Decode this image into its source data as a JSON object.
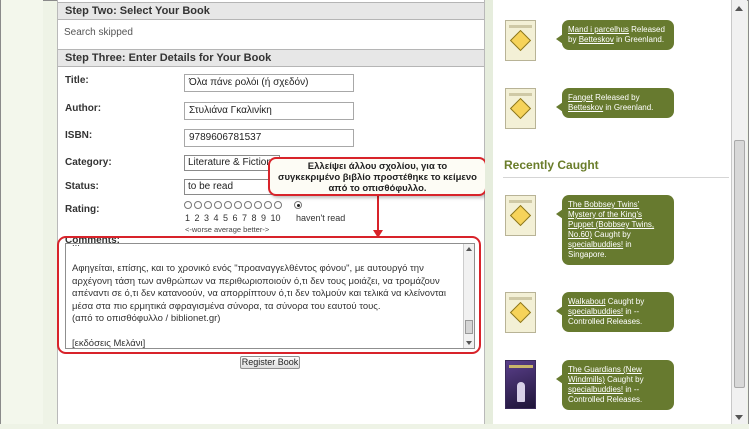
{
  "form": {
    "step_two_title": "Step Two: Select Your Book",
    "search_skipped": "Search skipped",
    "step_three_title": "Step Three: Enter Details for Your Book",
    "title_label": "Title:",
    "title_value": "Όλα πάνε ρολόι (ή σχεδόν)",
    "author_label": "Author:",
    "author_value": "Στυλιάνα Γκαλινίκη",
    "isbn_label": "ISBN:",
    "isbn_value": "9789606781537",
    "category_label": "Category:",
    "category_value": "Literature & Fiction",
    "status_label": "Status:",
    "status_value": "to be read",
    "rating_label": "Rating:",
    "rating_numbers": "1 2 3 4 5 6 7 8 9 10",
    "rating_havent": "haven't read",
    "rating_scale": "<-worse    average    better->",
    "rating_selected": "haven't read",
    "comments_label": "Comments:",
    "comments_text": "...\n\nΑφηγείται, επίσης, και το χρονικό ενός \"προαναγγελθέντος φόνου\", με αυτουργό την αρχέγονη τάση των ανθρώπων να περιθωριοποιούν ό,τι δεν τους μοιάζει, να τρομάζουν απέναντι σε ό,τι δεν κατανοούν, να απορρίπτουν ό,τι δεν τολμούν και τελικά να κλείνονται μέσα στα πιο ερμητικά σφραγισμένα σύνορα, τα σύνορα του εαυτού τους.\n(από το οπισθόφυλλο / biblionet.gr)\n\n[εκδόσεις Μελάνι]",
    "register_button": "Register Book"
  },
  "callout": {
    "text": "Ελλείψει άλλου σχολίου, για το συγκεκριμένο βιβλίο προστέθηκε το κείμενο από το οπισθόφυλλο."
  },
  "sidebar": {
    "releases": [
      {
        "title": "Mand i parcelhus",
        "line1": "Released by",
        "user": "Betteskov",
        "place": "in Greenland."
      },
      {
        "title": "Fanget",
        "line1": "Released by",
        "user": "Betteskov",
        "place": "in Greenland."
      }
    ],
    "recently_caught_title": "Recently Caught",
    "caught": [
      {
        "title": "The Bobbsey Twins' Mystery of the King's Puppet (Bobbsey Twins, No.60)",
        "line1": "Caught by",
        "user": "specialbuddies!",
        "place": "in Singapore."
      },
      {
        "title": "Walkabout",
        "line1": "Caught by",
        "user": "specialbuddies!",
        "place": "in -- Controlled Releases."
      },
      {
        "title": "The Guardians (New Windmills)",
        "line1": "Caught by",
        "user": "specialbuddies!",
        "place": "in -- Controlled Releases."
      }
    ]
  },
  "colors": {
    "accent_red": "#d8232a",
    "bubble_green": "#677a2f",
    "heading_green": "#6a7d2a"
  }
}
